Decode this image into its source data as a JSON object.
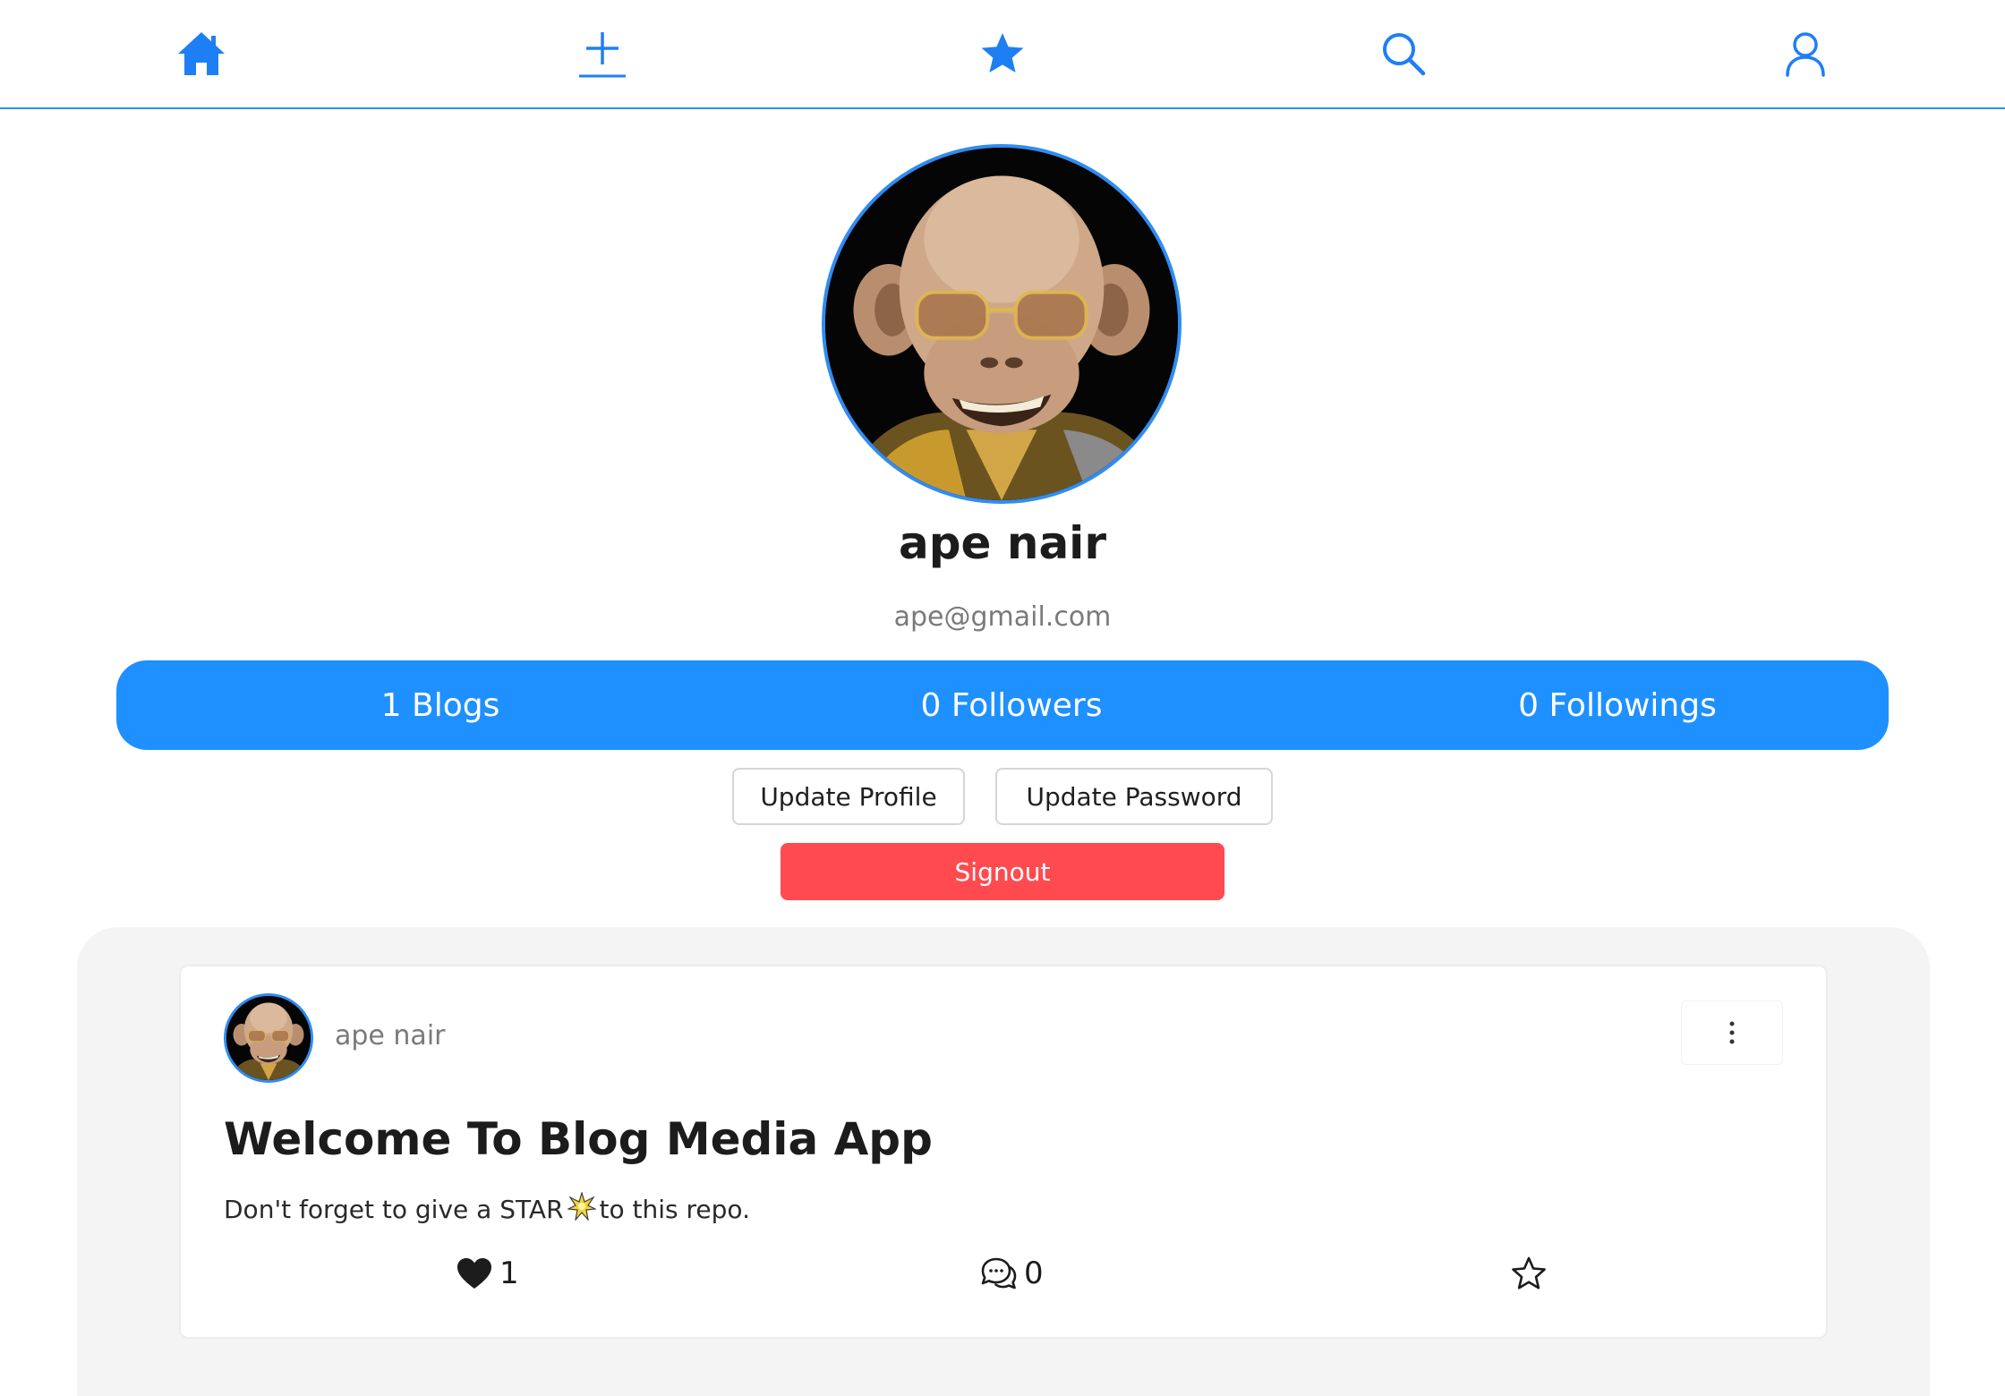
{
  "nav": {
    "items": [
      {
        "name": "home",
        "icon": "home-icon",
        "active": true
      },
      {
        "name": "create",
        "icon": "plus-icon",
        "active": false
      },
      {
        "name": "starred",
        "icon": "star-icon",
        "active": false
      },
      {
        "name": "search",
        "icon": "search-icon",
        "active": false
      },
      {
        "name": "profile",
        "icon": "user-icon",
        "active": false
      }
    ],
    "accent_color": "#1e7ff5"
  },
  "profile": {
    "name": "ape nair",
    "email": "ape@gmail.com",
    "avatar_icon": "ape-avatar"
  },
  "stats": {
    "blogs": "1 Blogs",
    "followers": "0 Followers",
    "followings": "0 Followings",
    "bar_color": "#1e90ff"
  },
  "actions": {
    "update_profile": "Update Profile",
    "update_password": "Update Password",
    "signout": "Signout",
    "signout_color": "#ff4a4f"
  },
  "posts": [
    {
      "author": "ape nair",
      "title": "Welcome To Blog Media App",
      "body_before": "Don't forget to give a STAR",
      "body_emoji": "sparkle-emoji",
      "body_after": "to this repo.",
      "likes": "1",
      "comments": "0",
      "menu_icon": "more-vertical-icon"
    }
  ]
}
